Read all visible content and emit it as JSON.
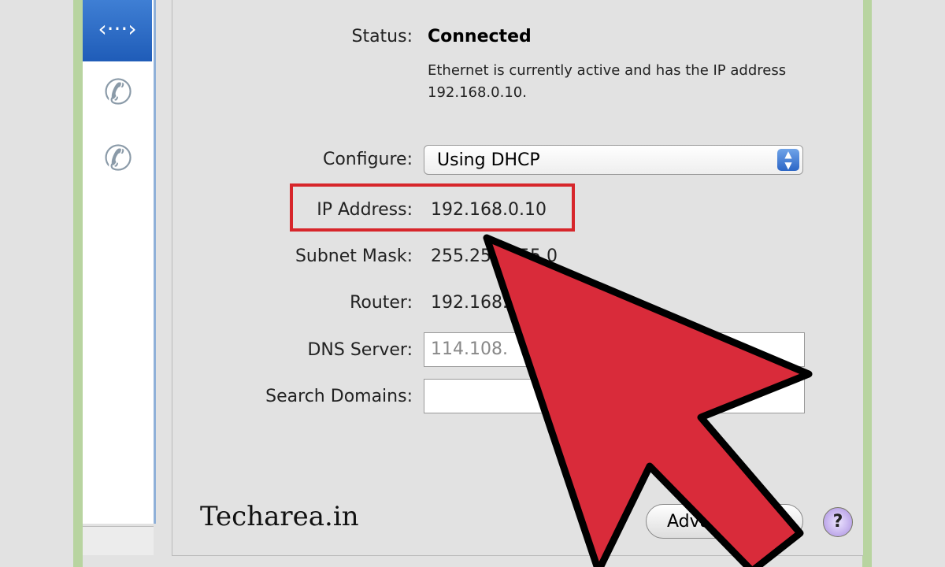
{
  "sidebar": {
    "selected_icon": "ethernet-icon",
    "selected_glyph": "‹···›",
    "items": [
      {
        "icon": "phone-modem-icon",
        "glyph": "✆"
      },
      {
        "icon": "phone-modem-icon",
        "glyph": "✆"
      }
    ]
  },
  "status": {
    "label": "Status:",
    "value": "Connected",
    "description": "Ethernet is currently active and has the IP address 192.168.0.10."
  },
  "configure": {
    "label": "Configure:",
    "value": "Using DHCP"
  },
  "ip": {
    "label": "IP Address:",
    "value": "192.168.0.10"
  },
  "subnet": {
    "label": "Subnet Mask:",
    "value": "255.255.255.0"
  },
  "router": {
    "label": "Router:",
    "value": "192.168.0.1"
  },
  "dns": {
    "label": "DNS Server:",
    "value": "114.108."
  },
  "search": {
    "label": "Search Domains:",
    "value": ""
  },
  "buttons": {
    "advanced": "Advanced...",
    "help": "?"
  },
  "watermark": "Techarea.in",
  "colors": {
    "highlight": "#d7262b",
    "arrow": "#d92b3a",
    "selection": "#2c66c6"
  }
}
